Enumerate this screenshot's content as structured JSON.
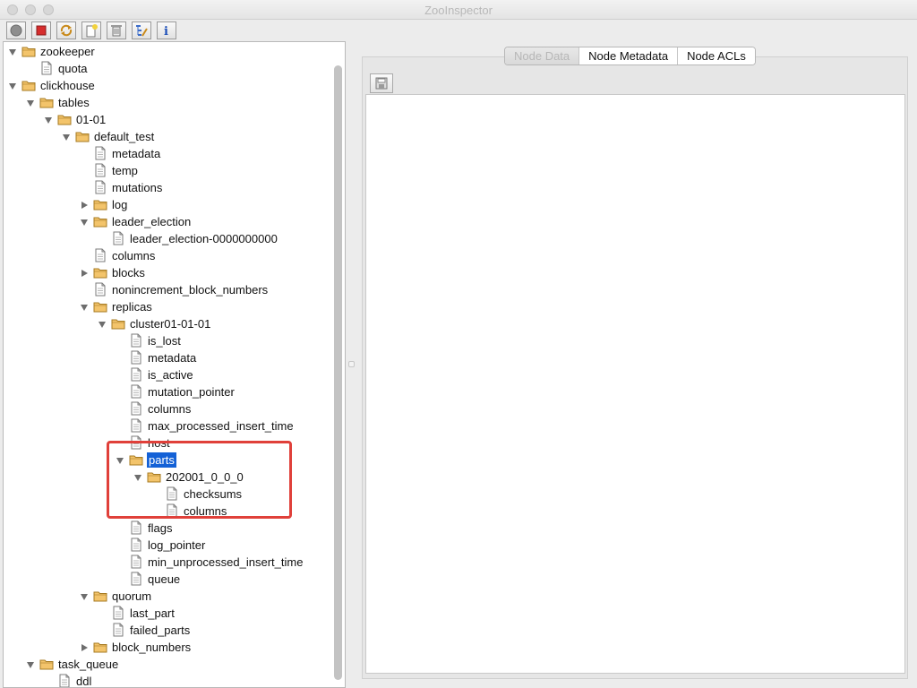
{
  "window": {
    "title": "ZooInspector"
  },
  "toolbar": {
    "buttons": [
      {
        "name": "connect-button",
        "icon": "connect-icon"
      },
      {
        "name": "disconnect-button",
        "icon": "disconnect-icon"
      },
      {
        "name": "refresh-button",
        "icon": "refresh-icon"
      },
      {
        "name": "add-node-button",
        "icon": "add-node-icon"
      },
      {
        "name": "delete-node-button",
        "icon": "trash-icon"
      },
      {
        "name": "node-viewers-button",
        "icon": "edit-viewers-icon"
      },
      {
        "name": "about-button",
        "icon": "info-icon"
      }
    ]
  },
  "tree": {
    "selected": "parts",
    "nodes": [
      {
        "label": "zookeeper",
        "depth": 0,
        "type": "folder",
        "expand": "open"
      },
      {
        "label": "quota",
        "depth": 1,
        "type": "file",
        "expand": "none"
      },
      {
        "label": "clickhouse",
        "depth": 0,
        "type": "folder",
        "expand": "open"
      },
      {
        "label": "tables",
        "depth": 1,
        "type": "folder",
        "expand": "open"
      },
      {
        "label": "01-01",
        "depth": 2,
        "type": "folder",
        "expand": "open"
      },
      {
        "label": "default_test",
        "depth": 3,
        "type": "folder",
        "expand": "open"
      },
      {
        "label": "metadata",
        "depth": 4,
        "type": "file",
        "expand": "none"
      },
      {
        "label": "temp",
        "depth": 4,
        "type": "file",
        "expand": "none"
      },
      {
        "label": "mutations",
        "depth": 4,
        "type": "file",
        "expand": "none"
      },
      {
        "label": "log",
        "depth": 4,
        "type": "folder",
        "expand": "closed"
      },
      {
        "label": "leader_election",
        "depth": 4,
        "type": "folder",
        "expand": "open"
      },
      {
        "label": "leader_election-0000000000",
        "depth": 5,
        "type": "file",
        "expand": "none"
      },
      {
        "label": "columns",
        "depth": 4,
        "type": "file",
        "expand": "none"
      },
      {
        "label": "blocks",
        "depth": 4,
        "type": "folder",
        "expand": "closed"
      },
      {
        "label": "nonincrement_block_numbers",
        "depth": 4,
        "type": "file",
        "expand": "none"
      },
      {
        "label": "replicas",
        "depth": 4,
        "type": "folder",
        "expand": "open"
      },
      {
        "label": "cluster01-01-01",
        "depth": 5,
        "type": "folder",
        "expand": "open"
      },
      {
        "label": "is_lost",
        "depth": 6,
        "type": "file",
        "expand": "none"
      },
      {
        "label": "metadata",
        "depth": 6,
        "type": "file",
        "expand": "none"
      },
      {
        "label": "is_active",
        "depth": 6,
        "type": "file",
        "expand": "none"
      },
      {
        "label": "mutation_pointer",
        "depth": 6,
        "type": "file",
        "expand": "none"
      },
      {
        "label": "columns",
        "depth": 6,
        "type": "file",
        "expand": "none"
      },
      {
        "label": "max_processed_insert_time",
        "depth": 6,
        "type": "file",
        "expand": "none"
      },
      {
        "label": "host",
        "depth": 6,
        "type": "file",
        "expand": "none"
      },
      {
        "label": "parts",
        "depth": 6,
        "type": "folder",
        "expand": "open"
      },
      {
        "label": "202001_0_0_0",
        "depth": 7,
        "type": "folder",
        "expand": "open"
      },
      {
        "label": "checksums",
        "depth": 8,
        "type": "file",
        "expand": "none"
      },
      {
        "label": "columns",
        "depth": 8,
        "type": "file",
        "expand": "none"
      },
      {
        "label": "flags",
        "depth": 6,
        "type": "file",
        "expand": "none"
      },
      {
        "label": "log_pointer",
        "depth": 6,
        "type": "file",
        "expand": "none"
      },
      {
        "label": "min_unprocessed_insert_time",
        "depth": 6,
        "type": "file",
        "expand": "none"
      },
      {
        "label": "queue",
        "depth": 6,
        "type": "file",
        "expand": "none"
      },
      {
        "label": "quorum",
        "depth": 4,
        "type": "folder",
        "expand": "open"
      },
      {
        "label": "last_part",
        "depth": 5,
        "type": "file",
        "expand": "none"
      },
      {
        "label": "failed_parts",
        "depth": 5,
        "type": "file",
        "expand": "none"
      },
      {
        "label": "block_numbers",
        "depth": 4,
        "type": "folder",
        "expand": "closed"
      },
      {
        "label": "task_queue",
        "depth": 1,
        "type": "folder",
        "expand": "open"
      },
      {
        "label": "ddl",
        "depth": 2,
        "type": "file",
        "expand": "none"
      }
    ]
  },
  "tabs": [
    {
      "label": "Node Data",
      "active": true
    },
    {
      "label": "Node Metadata",
      "active": false
    },
    {
      "label": "Node ACLs",
      "active": false
    }
  ],
  "editor": {
    "content": ""
  },
  "colors": {
    "selection": "#1461d6",
    "highlight_box": "#e0403a",
    "folder": "#f3c46b",
    "stop_red": "#d62d2d"
  }
}
